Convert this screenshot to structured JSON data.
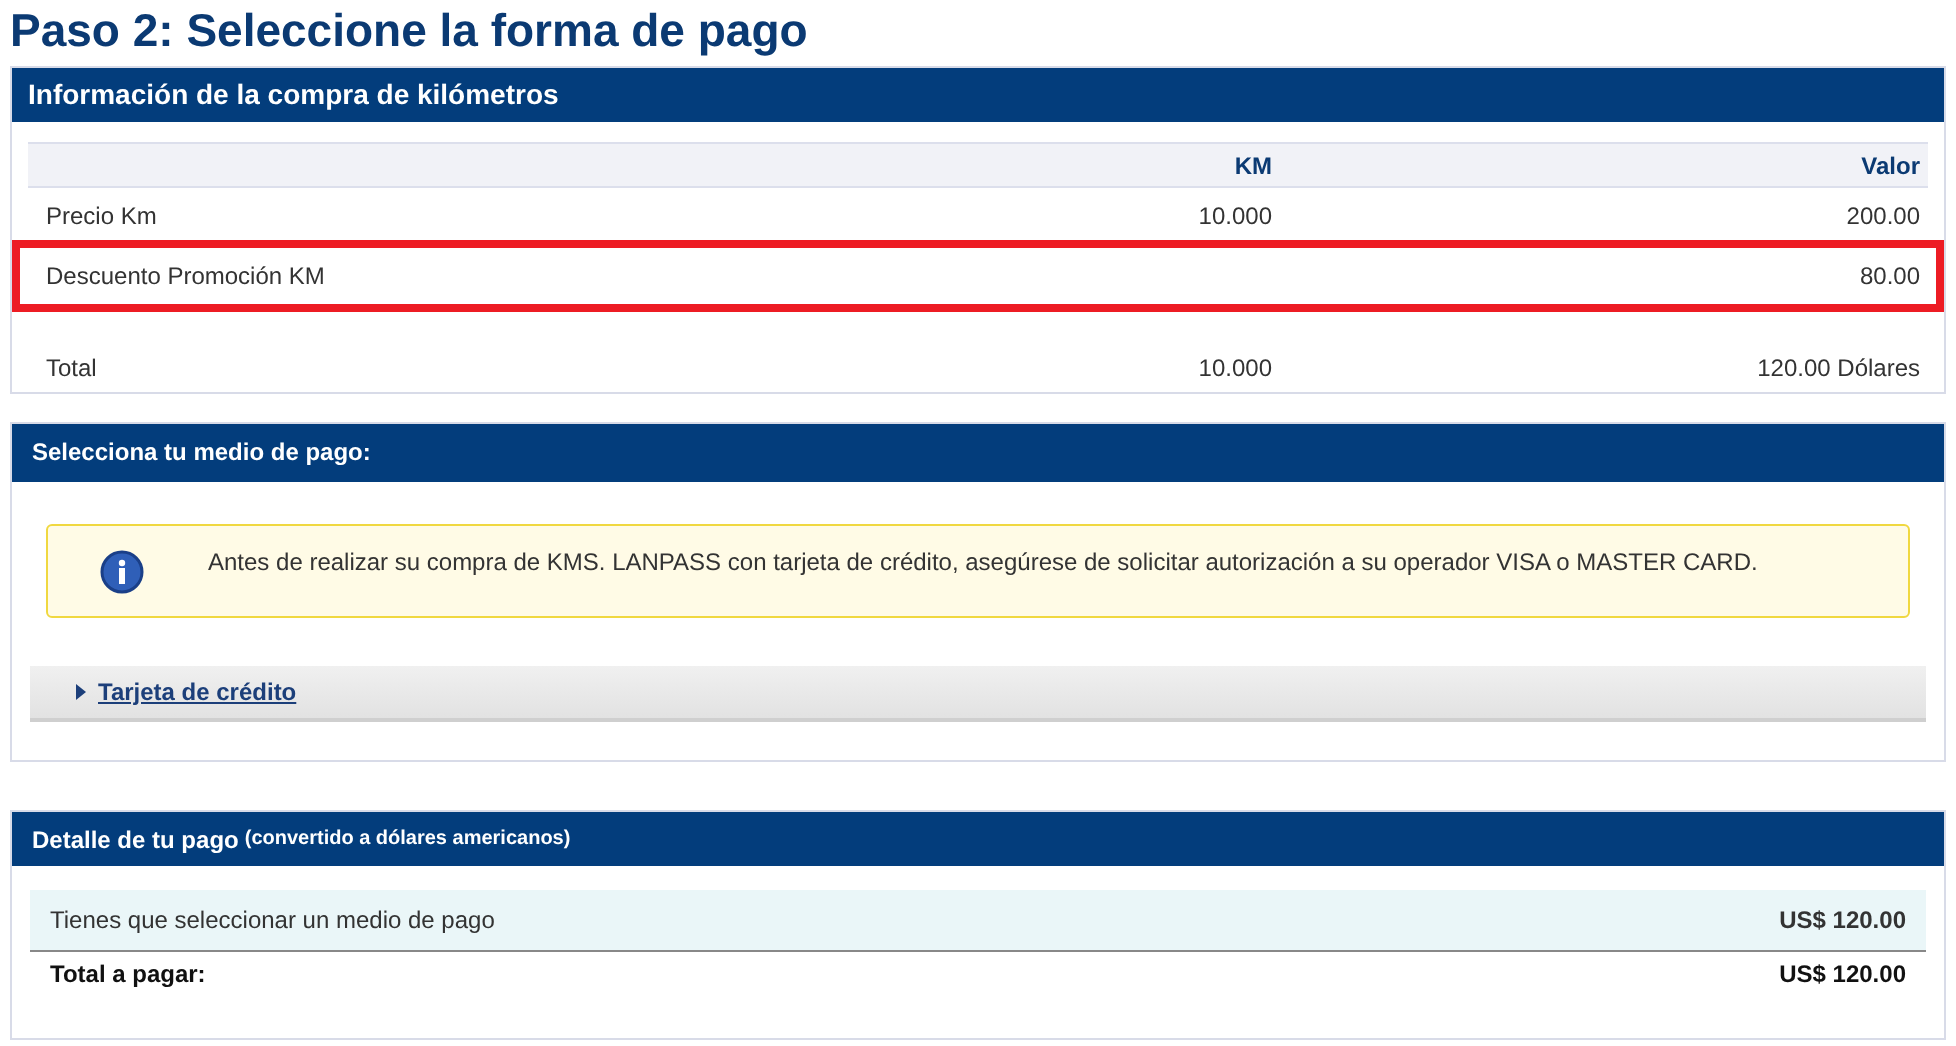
{
  "page_title": "Paso 2: Seleccione la forma de pago",
  "purchase_panel": {
    "title": "Información de la compra de kilómetros",
    "columns": [
      "KM",
      "Valor"
    ],
    "rows": [
      {
        "label": "Precio Km",
        "km": "10.000",
        "value": "200.00",
        "highlighted": false
      },
      {
        "label": "Descuento Promoción KM",
        "km": "",
        "value": "80.00",
        "highlighted": true
      }
    ],
    "total": {
      "label": "Total",
      "km": "10.000",
      "value": "120.00 Dólares"
    }
  },
  "payment_panel": {
    "title": "Selecciona tu medio de pago:",
    "notice": "Antes de realizar su compra de KMS. LANPASS con tarjeta de crédito, asegúrese de solicitar autorización a su operador VISA o MASTER CARD.",
    "methods": [
      {
        "label": "Tarjeta de crédito",
        "expanded": false
      }
    ]
  },
  "detail_panel": {
    "title": "Detalle de tu pago",
    "subtitle": "(convertido a dólares americanos)",
    "row": {
      "label": "Tienes que seleccionar un medio de pago",
      "value": "US$ 120.00"
    },
    "total": {
      "label": "Total a pagar:",
      "value": "US$ 120.00"
    }
  }
}
